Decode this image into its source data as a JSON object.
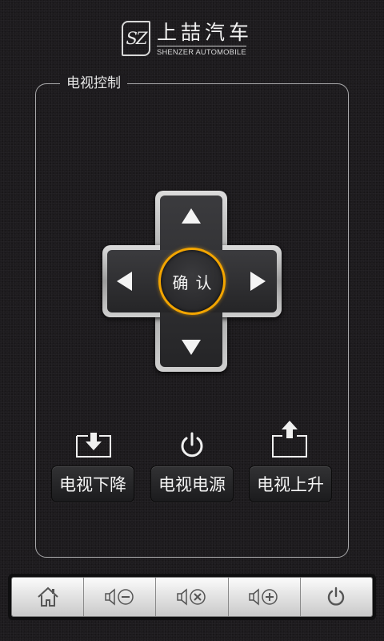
{
  "header": {
    "logo_badge": "SZ",
    "logo_cn": "上喆汽车",
    "logo_en": "SHENZER AUTOMOBILE"
  },
  "panel": {
    "title": "电视控制"
  },
  "dpad": {
    "ok_label": "确认",
    "up_icon": "arrow-up-icon",
    "down_icon": "arrow-down-icon",
    "left_icon": "arrow-left-icon",
    "right_icon": "arrow-right-icon"
  },
  "tv_buttons": [
    {
      "label": "电视下降",
      "icon": "tv-lower-icon"
    },
    {
      "label": "电视电源",
      "icon": "power-icon"
    },
    {
      "label": "电视上升",
      "icon": "tv-raise-icon"
    }
  ],
  "bottom_bar": [
    {
      "icon": "home-icon"
    },
    {
      "icon": "volume-mute-icon"
    },
    {
      "icon": "volume-down-icon"
    },
    {
      "icon": "volume-up-icon"
    },
    {
      "icon": "power-icon"
    }
  ],
  "colors": {
    "accent": "#f3a500",
    "background": "#1d1b1e"
  }
}
